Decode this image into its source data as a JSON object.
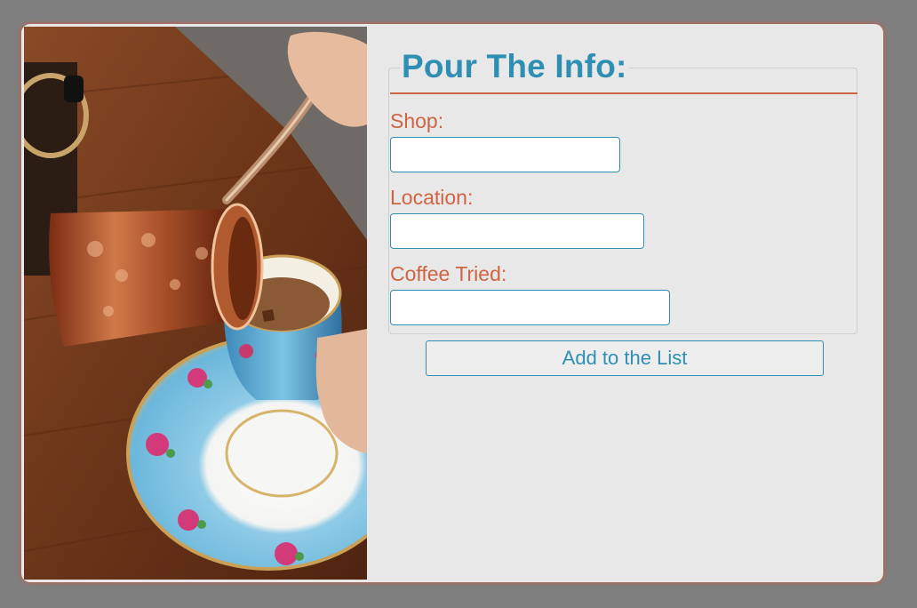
{
  "photo": {
    "alt": "Turkish coffee being poured from a copper cezve into a floral cup"
  },
  "form": {
    "title": "Pour The Info:",
    "fields": [
      {
        "label": "Shop:",
        "value": "",
        "placeholder": ""
      },
      {
        "label": "Location:",
        "value": "",
        "placeholder": ""
      },
      {
        "label": "Coffee Tried:",
        "value": "",
        "placeholder": ""
      }
    ],
    "submit_label": "Add to the List"
  },
  "colors": {
    "background": "#7f7f7f",
    "card": "#e8e8e8",
    "title_blue": "#2f8fb3",
    "label_orange": "#cf6443",
    "border_shadow": "#b06958"
  }
}
